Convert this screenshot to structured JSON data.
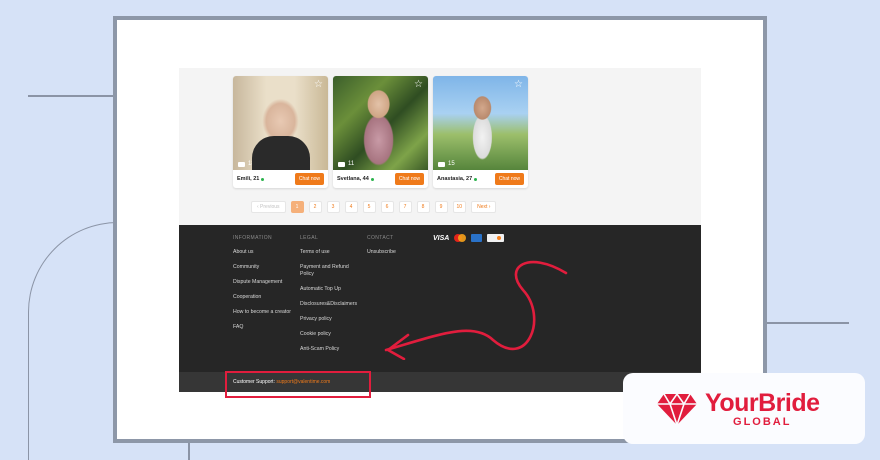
{
  "profiles": [
    {
      "name": "Emili, 21",
      "photos": "18",
      "chat_label": "Chat now"
    },
    {
      "name": "Svetlana, 44",
      "photos": "11",
      "chat_label": "Chat now"
    },
    {
      "name": "Anastasia, 27",
      "photos": "15",
      "chat_label": "Chat now"
    }
  ],
  "pagination": {
    "prev": "‹  Previous",
    "pages": [
      "1",
      "2",
      "3",
      "4",
      "5",
      "6",
      "7",
      "8",
      "9",
      "10"
    ],
    "active": "1",
    "next": "Next  ›"
  },
  "footer": {
    "information": {
      "heading": "INFORMATION",
      "links": [
        "About us",
        "Community",
        "Dispute Management",
        "Cooperation",
        "How to become a creator",
        "FAQ"
      ]
    },
    "legal": {
      "heading": "LEGAL",
      "links": [
        "Terms of use",
        "Payment and Refund Policy",
        "Automatic Top Up",
        "Disclosures&Disclaimers",
        "Privacy policy",
        "Cookie policy",
        "Anti-Scam Policy"
      ]
    },
    "contact": {
      "heading": "CONTACT",
      "links": [
        "Unsubscribe"
      ]
    },
    "payments": {
      "visa": "VISA"
    }
  },
  "support": {
    "label": "Customer Support:",
    "email": "support@valentime.com"
  },
  "brand": {
    "main": "YourBride",
    "sub": "GLOBAL",
    "color": "#e11d3d"
  },
  "colors": {
    "accent": "#ef7a1a",
    "highlight": "#e11d3d",
    "footer_bg": "#262626"
  }
}
